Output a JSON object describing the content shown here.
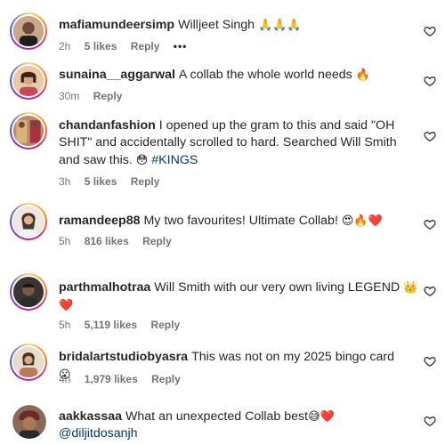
{
  "comments": [
    {
      "username": "mafiamundeersimp",
      "text": "Willjeet Singh",
      "emoji": "🙏🙏🙏",
      "time": "2h",
      "likes": "5 likes",
      "reply": "Reply",
      "more": "•••"
    },
    {
      "username": "sunaina__aggarwal",
      "text": "A collab the whole world needs",
      "emoji": "🔥",
      "time": "30m",
      "reply": "Reply"
    },
    {
      "username": "chandanfashion",
      "text": "I opened up the gram to this and said \"OH SHIT\" and accidentally scrolled to hard. Searched Will Smith and saw this.",
      "emoji": "😳",
      "hashtag": "#KINGS",
      "time": "3h",
      "likes": "5 likes",
      "reply": "Reply"
    },
    {
      "username": "ramandeep88",
      "text": "My two favourites! Ultimate Collab!",
      "emoji": "😍🔥❤️",
      "time": "5h",
      "likes": "816 likes",
      "reply": "Reply"
    },
    {
      "username": "parthmalhotraa",
      "text": "Will Smith with our very own living LEGEND",
      "emoji": "👑❤️",
      "time": "5h",
      "likes": "5,119 likes",
      "reply": "Reply"
    },
    {
      "username": "bridalartstudiobyasra",
      "text": "This was not on my 2025 bingo card",
      "emoji": "😮",
      "time": "4h",
      "likes": "1,979 likes",
      "reply": "Reply"
    },
    {
      "username": "aakkassaa",
      "text": "What an unexpected Collab best",
      "emoji": "😅❤️",
      "mention": "@diljitdosanjh"
    }
  ],
  "colors": {
    "text": "#262626",
    "meta": "#737373",
    "link": "#00376b"
  },
  "icons": {
    "like": "heart-outline-icon"
  }
}
